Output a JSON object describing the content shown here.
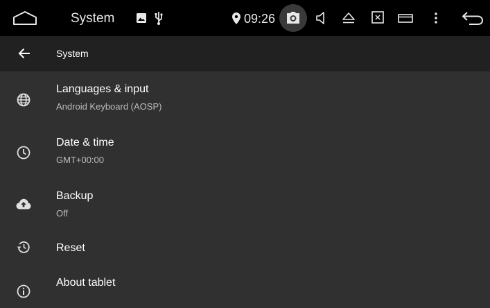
{
  "status_bar": {
    "title": "System",
    "time": "09:26",
    "icons": [
      "home-icon",
      "image-icon",
      "usb-icon",
      "location-icon",
      "camera-icon",
      "volume-icon",
      "eject-icon",
      "close-window-icon",
      "window-icon",
      "more-vert-icon",
      "back-arrow-icon"
    ]
  },
  "toolbar": {
    "title": "System"
  },
  "settings": {
    "items": [
      {
        "title": "Languages & input",
        "subtitle": "Android Keyboard (AOSP)",
        "icon": "globe-icon"
      },
      {
        "title": "Date & time",
        "subtitle": "GMT+00:00",
        "icon": "clock-icon"
      },
      {
        "title": "Backup",
        "subtitle": "Off",
        "icon": "cloud-upload-icon"
      },
      {
        "title": "Reset",
        "subtitle": "",
        "icon": "restore-icon"
      },
      {
        "title": "About tablet",
        "subtitle": "",
        "icon": "info-icon"
      }
    ]
  },
  "colors": {
    "status_bar_bg": "#000000",
    "toolbar_bg": "#212121",
    "content_bg": "#303030",
    "text_primary": "#ffffff",
    "text_secondary": "#bdbdbd"
  }
}
